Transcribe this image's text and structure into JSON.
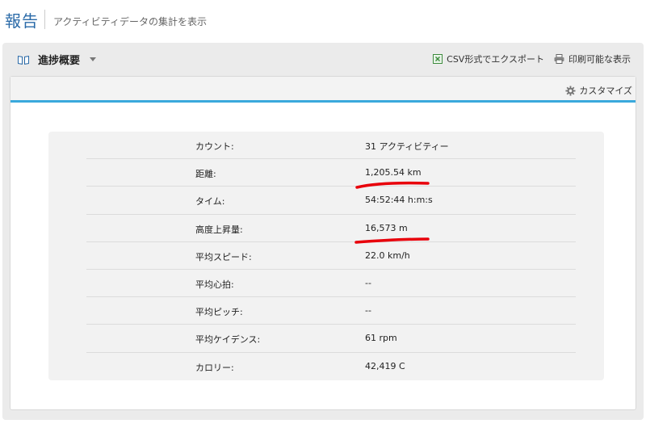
{
  "header": {
    "title": "報告",
    "subtitle": "アクティビティデータの集計を表示"
  },
  "toolbar": {
    "report_name": "進捗概要",
    "export_csv_label": "CSV形式でエクスポート",
    "print_label": "印刷可能な表示"
  },
  "card": {
    "customize_label": "カスタマイズ"
  },
  "summary": {
    "rows": [
      {
        "label": "カウント:",
        "value": "31 アクティビティー"
      },
      {
        "label": "距離:",
        "value": "1,205.54 km"
      },
      {
        "label": "タイム:",
        "value": "54:52:44 h:m:s"
      },
      {
        "label": "高度上昇量:",
        "value": "16,573 m"
      },
      {
        "label": "平均スピード:",
        "value": "22.0 km/h"
      },
      {
        "label": "平均心拍:",
        "value": "--"
      },
      {
        "label": "平均ピッチ:",
        "value": "--"
      },
      {
        "label": "平均ケイデンス:",
        "value": "61 rpm"
      },
      {
        "label": "カロリー:",
        "value": "42,419 C"
      }
    ]
  },
  "colors": {
    "title_blue": "#2a6aa8",
    "accent_blue": "#3aa9dc",
    "annotation_red": "#e8000b",
    "excel_green": "#3b8a3b"
  },
  "icons": {
    "report": "book-icon",
    "dropdown": "caret-down-icon",
    "export": "excel-icon",
    "print": "printer-icon",
    "customize": "gear-icon"
  }
}
